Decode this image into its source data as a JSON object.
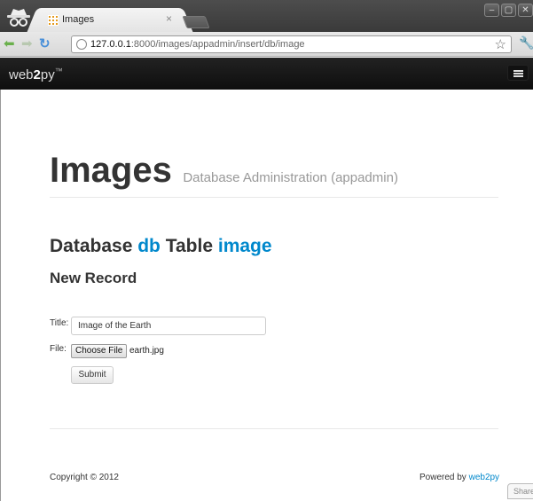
{
  "browser": {
    "tab_title": "Images",
    "tab_close": "×",
    "url_host": "127.0.0.1",
    "url_rest": ":8000/images/appadmin/insert/db/image",
    "icons": [
      "incognito-icon",
      "favicon-icon",
      "back-icon",
      "forward-icon",
      "reload-icon",
      "globe-icon",
      "star-icon",
      "wrench-icon"
    ],
    "window_buttons": [
      "–",
      "▢",
      "✕"
    ]
  },
  "navbar": {
    "brand_prefix": "web",
    "brand_bold": "2",
    "brand_suffix": "py",
    "brand_tm": "™"
  },
  "header": {
    "title": "Images",
    "subtitle": "Database Administration (appadmin)"
  },
  "content": {
    "heading_database": "Database",
    "heading_db_link": "db",
    "heading_table": "Table",
    "heading_table_link": "image",
    "subheading": "New Record"
  },
  "form": {
    "title_label": "Title:",
    "title_value": "Image of the Earth",
    "file_label": "File:",
    "choose_file_label": "Choose File",
    "file_name": "earth.jpg",
    "submit_label": "Submit"
  },
  "footer": {
    "copyright": "Copyright © 2012",
    "powered_by": "Powered by",
    "powered_link": "web2py",
    "share_label": "Share"
  },
  "colors": {
    "accent": "#0088cc",
    "navbar_bg": "#1b1b1b"
  }
}
